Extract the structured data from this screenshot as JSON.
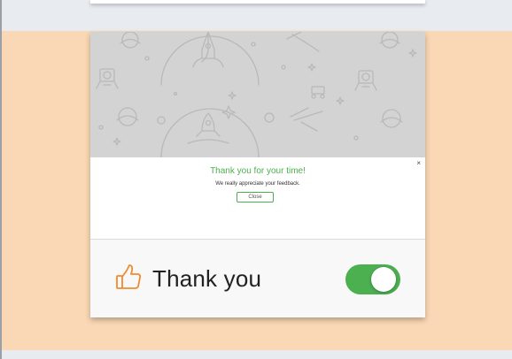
{
  "message": {
    "title": "Thank you for your time!",
    "body": "We really appreciate your feedback.",
    "close_button": "Close",
    "dismiss_symbol": "×"
  },
  "footer": {
    "icon": "thumbs-up-icon",
    "label": "Thank you",
    "toggle_on": true
  },
  "colors": {
    "accent_green": "#4caf50",
    "thumb_orange": "#f08a30",
    "page_peach": "#fad8b5",
    "hero_gray": "#d3d3d3"
  }
}
